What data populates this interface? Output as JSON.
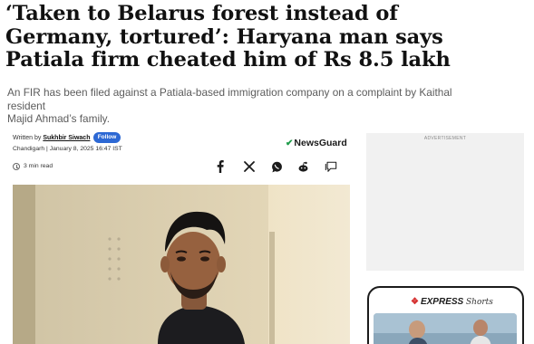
{
  "article": {
    "headline_line1": "‘Taken to Belarus forest instead of",
    "headline_line2": "Germany, tortured’: Haryana man says",
    "headline_line3": "Patiala firm cheated him of Rs 8.5 lakh",
    "subhead_line1": "An FIR has been filed against a Patiala-based immigration company on a complaint by Kaithal resident",
    "subhead_line2": "Majid Ahmad’s family."
  },
  "byline": {
    "written_by": "Written by",
    "author": "Sukhbir Siwach",
    "follow_label": "Follow",
    "location": "Chandigarh",
    "separator": "|",
    "date": "January 8, 2025 16:47 IST",
    "read_time": "3 min read"
  },
  "badge": {
    "newsguard": "NewsGuard"
  },
  "share_icons": [
    "facebook-icon",
    "x-icon",
    "whatsapp-icon",
    "reddit-icon",
    "comment-icon"
  ],
  "sidebar": {
    "ad_label": "ADVERTISEMENT",
    "shorts_brand": "EXPRESS",
    "shorts_suffix": "Shorts"
  },
  "colors": {
    "follow_button": "#2c68d4",
    "newsguard_check": "#1f9c4a",
    "subhead_text": "#5c5c5c",
    "ad_background": "#f1f1f1"
  }
}
